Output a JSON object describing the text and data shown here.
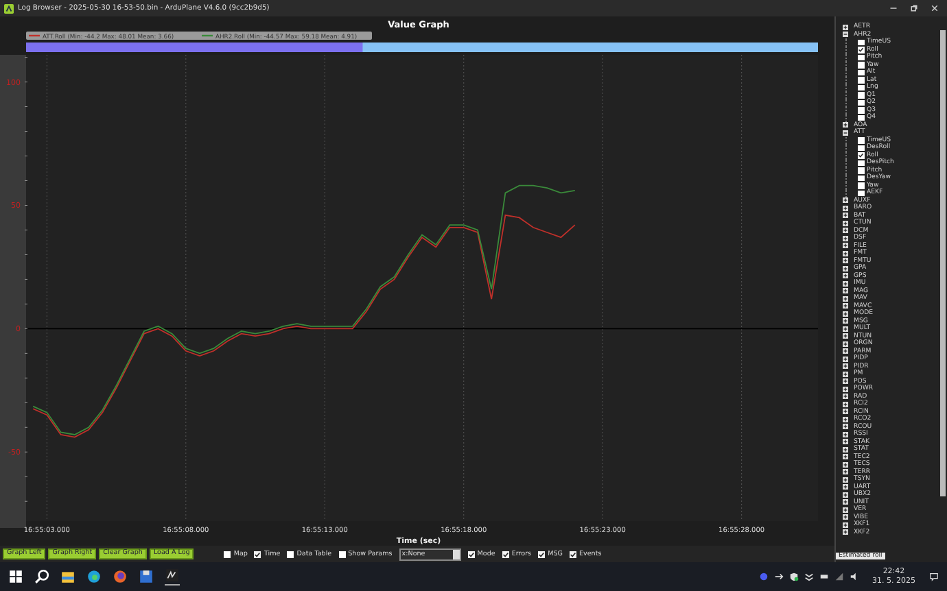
{
  "window": {
    "title": "Log Browser - 2025-05-30 16-53-50.bin - ArduPlane V4.6.0 (9cc2b9d5)"
  },
  "graph": {
    "legend": [
      {
        "stats": "(Min: -44.2 Max: 48.01 Mean: 3.66)"
      },
      {
        "stats": "(Min: -44.57 Max: 59.18 Mean: 4.91)"
      }
    ],
    "zoom_bar": {
      "level": 0.425
    },
    "chart_data": {
      "type": "line",
      "title": "Value Graph",
      "xlabel": "Time (sec)",
      "categories": [
        null,
        "16:55:03.000",
        null,
        null,
        null,
        null,
        null,
        null,
        null,
        null,
        null,
        "16:55:08.000",
        null,
        null,
        null,
        null,
        null,
        null,
        null,
        null,
        null,
        "16:55:13.000",
        null,
        null,
        null,
        null,
        null,
        null,
        null,
        null,
        null,
        "16:55:18.000",
        null,
        null,
        null,
        null,
        null,
        null,
        null,
        null,
        null,
        "16:55:23.000",
        null,
        null,
        null,
        null,
        null,
        null,
        null,
        null,
        null,
        "16:55:28.000",
        null,
        null,
        null,
        null,
        null
      ],
      "series": [
        {
          "name": "ATT.Roll",
          "color": "#c0302a",
          "values": [
            -32.5,
            -35,
            -43,
            -44,
            -41,
            -34,
            -24,
            -13,
            -2,
            0,
            -3,
            -9,
            -11,
            -9,
            -5,
            -2,
            -3,
            -2,
            0,
            1,
            0,
            0,
            0,
            0,
            7,
            16,
            20,
            29,
            37,
            33,
            41,
            41,
            39,
            12,
            46,
            45,
            41,
            39,
            37,
            42,
            null,
            null,
            null,
            null,
            null,
            null,
            null,
            null,
            null,
            null,
            null,
            null,
            null,
            null,
            null,
            null,
            null
          ]
        },
        {
          "name": "AHR2.Roll",
          "color": "#3a8a3a",
          "values": [
            -31.5,
            -34,
            -42,
            -43,
            -40,
            -33,
            -23,
            -12,
            -1,
            1,
            -2,
            -8,
            -10,
            -8,
            -4,
            -1,
            -2,
            -1,
            1,
            2,
            1,
            1,
            1,
            1,
            8,
            17,
            21,
            30,
            38,
            34,
            42,
            42,
            40,
            16,
            55,
            58,
            58,
            57,
            55,
            56,
            null,
            null,
            null,
            null,
            null,
            null,
            null,
            null,
            null,
            null,
            null,
            null,
            null,
            null,
            null,
            null,
            null
          ]
        }
      ],
      "ylim": [
        -78,
        111
      ],
      "grid": true,
      "yticks": [
        -50,
        0,
        50,
        100
      ]
    }
  },
  "tree": {
    "items": [
      {
        "label": "AETR",
        "expanded": false
      },
      {
        "label": "AHR2",
        "expanded": true,
        "children": [
          {
            "label": "TimeUS",
            "checked": false
          },
          {
            "label": "Roll",
            "checked": true
          },
          {
            "label": "Pitch",
            "checked": false
          },
          {
            "label": "Yaw",
            "checked": false
          },
          {
            "label": "Alt",
            "checked": false
          },
          {
            "label": "Lat",
            "checked": false
          },
          {
            "label": "Lng",
            "checked": false
          },
          {
            "label": "Q1",
            "checked": false
          },
          {
            "label": "Q2",
            "checked": false
          },
          {
            "label": "Q3",
            "checked": false
          },
          {
            "label": "Q4",
            "checked": false
          }
        ]
      },
      {
        "label": "AOA",
        "expanded": false
      },
      {
        "label": "ATT",
        "expanded": true,
        "children": [
          {
            "label": "TimeUS",
            "checked": false
          },
          {
            "label": "DesRoll",
            "checked": false
          },
          {
            "label": "Roll",
            "checked": true
          },
          {
            "label": "DesPitch",
            "checked": false
          },
          {
            "label": "Pitch",
            "checked": false
          },
          {
            "label": "DesYaw",
            "checked": false
          },
          {
            "label": "Yaw",
            "checked": false
          },
          {
            "label": "AEKF",
            "checked": false
          }
        ]
      },
      {
        "label": "AUXF",
        "expanded": false
      },
      {
        "label": "BARO",
        "expanded": false
      },
      {
        "label": "BAT",
        "expanded": false
      },
      {
        "label": "CTUN",
        "expanded": false
      },
      {
        "label": "DCM",
        "expanded": false
      },
      {
        "label": "DSF",
        "expanded": false
      },
      {
        "label": "FILE",
        "expanded": false
      },
      {
        "label": "FMT",
        "expanded": false
      },
      {
        "label": "FMTU",
        "expanded": false
      },
      {
        "label": "GPA",
        "expanded": false
      },
      {
        "label": "GPS",
        "expanded": false
      },
      {
        "label": "IMU",
        "expanded": false
      },
      {
        "label": "MAG",
        "expanded": false
      },
      {
        "label": "MAV",
        "expanded": false
      },
      {
        "label": "MAVC",
        "expanded": false
      },
      {
        "label": "MODE",
        "expanded": false
      },
      {
        "label": "MSG",
        "expanded": false
      },
      {
        "label": "MULT",
        "expanded": false
      },
      {
        "label": "NTUN",
        "expanded": false
      },
      {
        "label": "ORGN",
        "expanded": false
      },
      {
        "label": "PARM",
        "expanded": false
      },
      {
        "label": "PIDP",
        "expanded": false
      },
      {
        "label": "PIDR",
        "expanded": false
      },
      {
        "label": "PM",
        "expanded": false
      },
      {
        "label": "POS",
        "expanded": false
      },
      {
        "label": "POWR",
        "expanded": false
      },
      {
        "label": "RAD",
        "expanded": false
      },
      {
        "label": "RCI2",
        "expanded": false
      },
      {
        "label": "RCIN",
        "expanded": false
      },
      {
        "label": "RCO2",
        "expanded": false
      },
      {
        "label": "RCOU",
        "expanded": false
      },
      {
        "label": "RSSI",
        "expanded": false
      },
      {
        "label": "STAK",
        "expanded": false
      },
      {
        "label": "STAT",
        "expanded": false
      },
      {
        "label": "TEC2",
        "expanded": false
      },
      {
        "label": "TECS",
        "expanded": false
      },
      {
        "label": "TERR",
        "expanded": false
      },
      {
        "label": "TSYN",
        "expanded": false
      },
      {
        "label": "UART",
        "expanded": false
      },
      {
        "label": "UBX2",
        "expanded": false
      },
      {
        "label": "UNIT",
        "expanded": false
      },
      {
        "label": "VER",
        "expanded": false
      },
      {
        "label": "VIBE",
        "expanded": false
      },
      {
        "label": "XKF1",
        "expanded": false
      },
      {
        "label": "XKF2",
        "expanded": false
      }
    ],
    "tooltip": "Estimated roll"
  },
  "toolbar": {
    "buttons": [
      "Graph Left",
      "Graph Right",
      "Clear Graph",
      "Load A Log"
    ],
    "options_left": [
      {
        "label": "Map",
        "checked": false
      },
      {
        "label": "Time",
        "checked": true
      },
      {
        "label": "Data Table",
        "checked": false
      },
      {
        "label": "Show Params",
        "checked": false
      }
    ],
    "dropdown": {
      "value": "x:None"
    },
    "options_right": [
      {
        "label": "Mode",
        "checked": true
      },
      {
        "label": "Errors",
        "checked": true
      },
      {
        "label": "MSG",
        "checked": true
      },
      {
        "label": "Events",
        "checked": true
      }
    ]
  },
  "taskbar": {
    "time": "22:42",
    "date": "31. 5. 2025"
  }
}
